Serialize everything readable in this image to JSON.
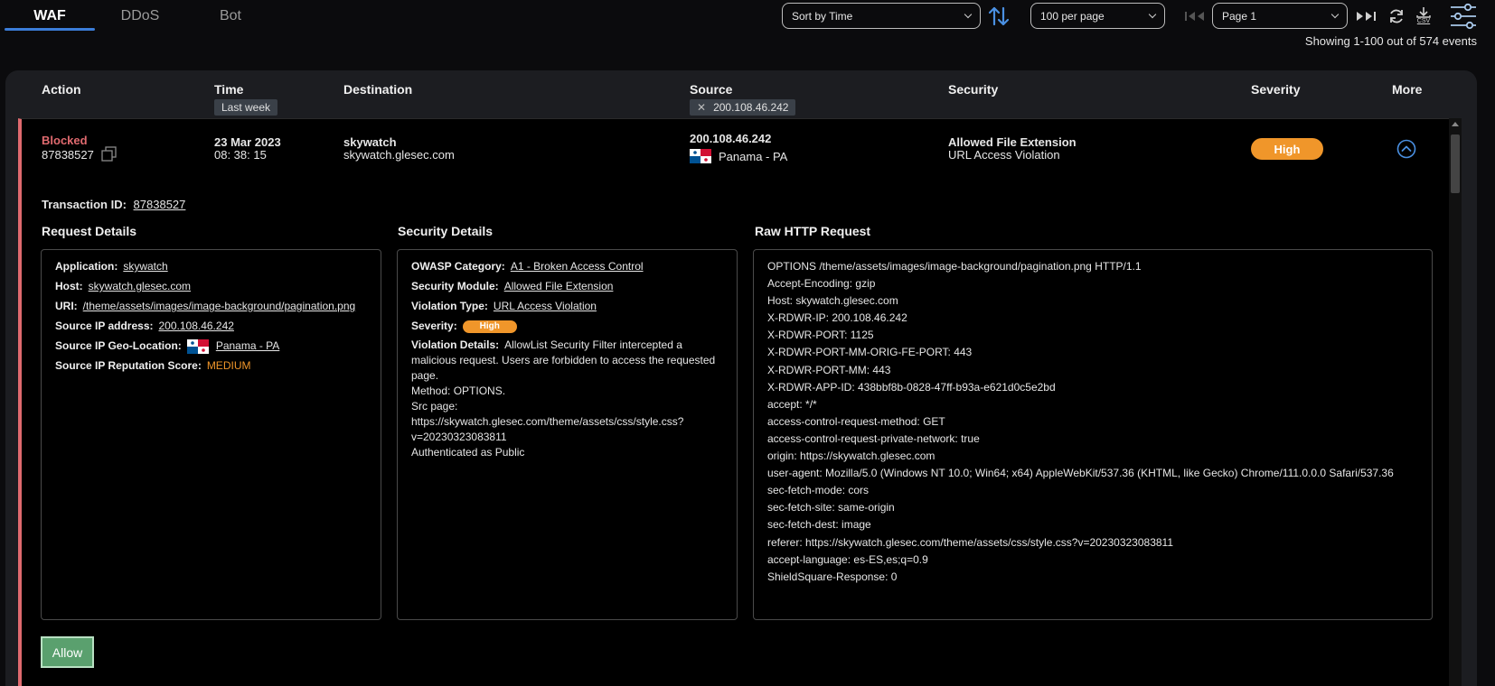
{
  "tabs": [
    {
      "label": "WAF",
      "active": true
    },
    {
      "label": "DDoS",
      "active": false
    },
    {
      "label": "Bot",
      "active": false
    }
  ],
  "toolbar": {
    "sort_value": "Sort by Time",
    "perpage_value": "100 per page",
    "page_value": "Page 1",
    "csv_label": "CSV",
    "showing_text": "Showing 1-100 out of 574 events"
  },
  "table": {
    "headers": {
      "action": "Action",
      "time": "Time",
      "destination": "Destination",
      "source": "Source",
      "security": "Security",
      "severity": "Severity",
      "more": "More"
    },
    "filters": {
      "time": "Last week",
      "source": "200.108.46.242"
    }
  },
  "row": {
    "action": "Blocked",
    "id": "87838527",
    "date": "23 Mar 2023",
    "time": "08: 38: 15",
    "dest_name": "skywatch",
    "dest_host": "skywatch.glesec.com",
    "source_ip": "200.108.46.242",
    "source_loc": "Panama - PA",
    "security_main": "Allowed File Extension",
    "security_sub": "URL Access Violation",
    "severity": "High"
  },
  "details": {
    "transaction_label": "Transaction ID:",
    "transaction_id": "87838527",
    "request_title": "Request Details",
    "security_title": "Security Details",
    "raw_title": "Raw HTTP Request",
    "request": {
      "application_k": "Application:",
      "application_v": "skywatch",
      "host_k": "Host:",
      "host_v": "skywatch.glesec.com",
      "uri_k": "URI:",
      "uri_v": "/theme/assets/images/image-background/pagination.png",
      "ip_k": "Source IP address:",
      "ip_v": "200.108.46.242",
      "geo_k": "Source IP Geo-Location:",
      "geo_v": "Panama - PA",
      "rep_k": "Source IP Reputation Score:",
      "rep_v": "MEDIUM"
    },
    "security": {
      "owasp_k": "OWASP Category:",
      "owasp_v": "A1 - Broken Access Control",
      "module_k": "Security Module:",
      "module_v": "Allowed File Extension",
      "violation_k": "Violation Type:",
      "violation_v": "URL Access Violation",
      "severity_k": "Severity:",
      "severity_v": "High",
      "details_k": "Violation Details:",
      "details_lines": [
        "AllowList Security Filter intercepted a",
        "malicious request. Users are forbidden to access the requested",
        "page.",
        "Method: OPTIONS.",
        "Src page:",
        "https://skywatch.glesec.com/theme/assets/css/style.css?",
        "v=20230323083811",
        "Authenticated as Public"
      ]
    },
    "raw_lines": [
      "OPTIONS /theme/assets/images/image-background/pagination.png HTTP/1.1",
      "Accept-Encoding: gzip",
      "Host: skywatch.glesec.com",
      "X-RDWR-IP: 200.108.46.242",
      "X-RDWR-PORT: 1125",
      "X-RDWR-PORT-MM-ORIG-FE-PORT: 443",
      "X-RDWR-PORT-MM: 443",
      "X-RDWR-APP-ID: 438bbf8b-0828-47ff-b93a-e621d0c5e2bd",
      "accept: */*",
      "access-control-request-method: GET",
      "access-control-request-private-network: true",
      "origin: https://skywatch.glesec.com",
      "user-agent: Mozilla/5.0 (Windows NT 10.0; Win64; x64) AppleWebKit/537.36 (KHTML, like Gecko) Chrome/111.0.0.0 Safari/537.36",
      "sec-fetch-mode: cors",
      "sec-fetch-site: same-origin",
      "sec-fetch-dest: image",
      "referer: https://skywatch.glesec.com/theme/assets/css/style.css?v=20230323083811",
      "accept-language: es-ES,es;q=0.9",
      "ShieldSquare-Response: 0"
    ],
    "allow_label": "Allow"
  },
  "colors": {
    "accent": "#3b7dd8",
    "blocked": "#e06a6f",
    "high": "#f0962a",
    "allow": "#5aa06e"
  }
}
